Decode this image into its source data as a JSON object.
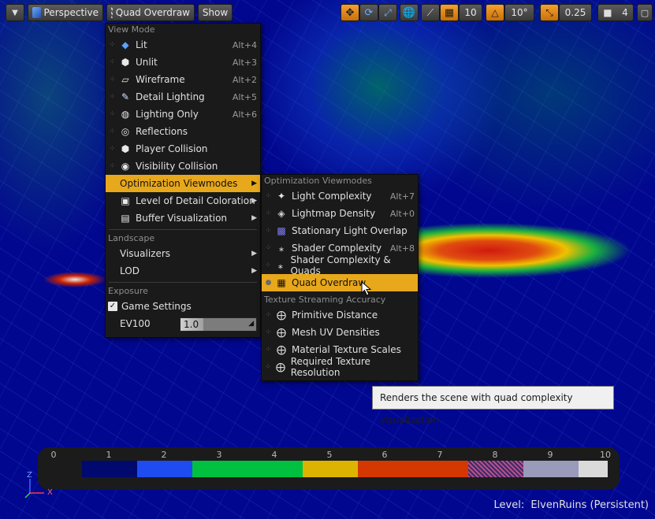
{
  "toolbar": {
    "perspective_label": "Perspective",
    "viewmode_label": "Quad Overdraw",
    "show_label": "Show",
    "grid_snap_value": "10",
    "rotation_snap_value": "10°",
    "scale_snap_value": "0.25",
    "camera_speed_value": "4"
  },
  "view_menu": {
    "section_view_mode": "View Mode",
    "items": [
      {
        "label": "Lit",
        "shortcut": "Alt+4",
        "icon": "lit-icon"
      },
      {
        "label": "Unlit",
        "shortcut": "Alt+3",
        "icon": "unlit-icon"
      },
      {
        "label": "Wireframe",
        "shortcut": "Alt+2",
        "icon": "wireframe-icon"
      },
      {
        "label": "Detail Lighting",
        "shortcut": "Alt+5",
        "icon": "detail-lighting-icon"
      },
      {
        "label": "Lighting Only",
        "shortcut": "Alt+6",
        "icon": "lighting-only-icon"
      },
      {
        "label": "Reflections",
        "shortcut": "",
        "icon": "reflections-icon"
      },
      {
        "label": "Player Collision",
        "shortcut": "",
        "icon": "player-collision-icon"
      },
      {
        "label": "Visibility Collision",
        "shortcut": "",
        "icon": "visibility-collision-icon"
      }
    ],
    "optimization_label": "Optimization Viewmodes",
    "lod_coloration_label": "Level of Detail Coloration",
    "buffer_visualization_label": "Buffer Visualization",
    "section_landscape": "Landscape",
    "visualizers_label": "Visualizers",
    "lod_label": "LOD",
    "section_exposure": "Exposure",
    "game_settings_label": "Game Settings",
    "game_settings_checked": true,
    "ev100_label": "EV100",
    "ev100_value": "1.0"
  },
  "opt_menu": {
    "section_optimization": "Optimization Viewmodes",
    "items": [
      {
        "label": "Light Complexity",
        "shortcut": "Alt+7",
        "icon": "light-complexity-icon"
      },
      {
        "label": "Lightmap Density",
        "shortcut": "Alt+0",
        "icon": "lightmap-density-icon"
      },
      {
        "label": "Stationary Light Overlap",
        "shortcut": "",
        "icon": "stationary-light-overlap-icon"
      },
      {
        "label": "Shader Complexity",
        "shortcut": "Alt+8",
        "icon": "shader-complexity-icon"
      },
      {
        "label": "Shader Complexity & Quads",
        "shortcut": "",
        "icon": "shader-complexity-quads-icon"
      },
      {
        "label": "Quad Overdraw",
        "shortcut": "",
        "icon": "quad-overdraw-icon"
      }
    ],
    "section_texture": "Texture Streaming Accuracy",
    "texture_items": [
      {
        "label": "Primitive Distance"
      },
      {
        "label": "Mesh UV Densities"
      },
      {
        "label": "Material Texture Scales"
      },
      {
        "label": "Required Texture Resolution"
      }
    ]
  },
  "tooltip": {
    "text": "Renders the scene with quad complexity visualization"
  },
  "legend": {
    "labels": [
      "0",
      "1",
      "2",
      "3",
      "4",
      "5",
      "6",
      "7",
      "8",
      "9",
      "10"
    ],
    "colors": [
      "#000a6e",
      "#1e4cf0",
      "#00c040",
      "#00c040",
      "#dcb400",
      "#d43800",
      "#d43800",
      "#b04878",
      "#9a9aba",
      "#dadada"
    ]
  },
  "status": {
    "level_label": "Level:",
    "level_name": "ElvenRuins (Persistent)"
  },
  "axis": {
    "x_label": "X",
    "z_label": "Z"
  }
}
